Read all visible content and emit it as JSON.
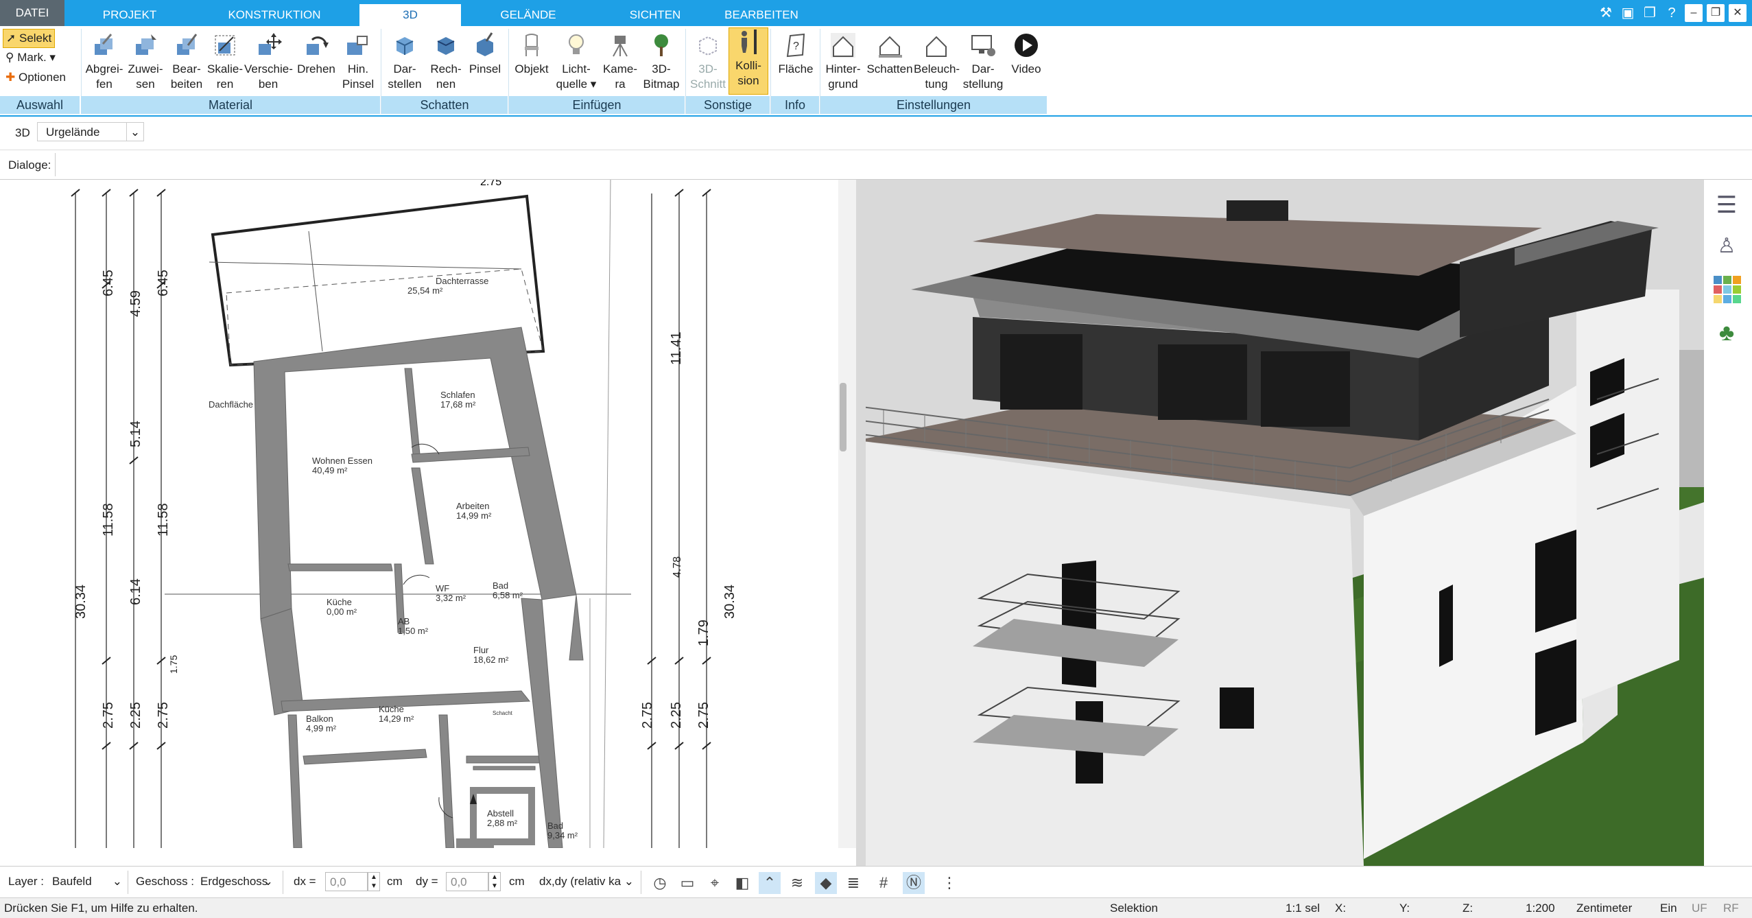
{
  "tabs": {
    "file": "DATEI",
    "project": "PROJEKT",
    "construction": "KONSTRUKTION",
    "threed": "3D",
    "terrain": "GELÄNDE",
    "views": "SICHTEN",
    "edit": "BEARBEITEN"
  },
  "ribbon": {
    "selection": {
      "select": "Selekt",
      "mark": "Mark.",
      "options": "Optionen",
      "group": "Auswahl"
    },
    "material": {
      "b1": "Abgrei-",
      "b1b": "fen",
      "b2": "Zuwei-",
      "b2b": "sen",
      "b3": "Bear-",
      "b3b": "beiten",
      "b4": "Skalie-",
      "b4b": "ren",
      "b5": "Verschie-",
      "b5b": "ben",
      "b6": "Drehen",
      "b7": "Hin.",
      "b7b": "Pinsel",
      "group": "Material"
    },
    "shadow": {
      "b1": "Dar-",
      "b1b": "stellen",
      "b2": "Rech-",
      "b2b": "nen",
      "b3": "Pinsel",
      "group": "Schatten"
    },
    "insert": {
      "b1": "Objekt",
      "b2": "Licht-",
      "b2b": "quelle",
      "b3": "Kame-",
      "b3b": "ra",
      "b4": "3D-",
      "b4b": "Bitmap",
      "group": "Einfügen"
    },
    "other": {
      "b1": "3D-",
      "b1b": "Schnitt",
      "b2": "Kolli-",
      "b2b": "sion",
      "group": "Sonstige"
    },
    "info": {
      "b1": "Fläche",
      "group": "Info"
    },
    "settings": {
      "b1": "Hinter-",
      "b1b": "grund",
      "b2": "Schatten",
      "b3": "Beleuch-",
      "b3b": "tung",
      "b4": "Dar-",
      "b4b": "stellung",
      "b5": "Video",
      "group": "Einstellungen"
    }
  },
  "toolbar3d": {
    "mode": "3D",
    "terrain_select": "Urgelände"
  },
  "dialogs_label": "Dialoge:",
  "plan": {
    "top_dim": "2.75",
    "rooms": [
      {
        "name": "Dachterrasse",
        "area": "25,54 m²"
      },
      {
        "name": "Dachfläche",
        "area": ""
      },
      {
        "name": "Schlafen",
        "area": "17,68 m²"
      },
      {
        "name": "Wohnen Essen",
        "area": "40,49 m²"
      },
      {
        "name": "Arbeiten",
        "area": "14,99 m²"
      },
      {
        "name": "Küche",
        "area": "0,00 m²"
      },
      {
        "name": "WF",
        "area": "3,32 m²"
      },
      {
        "name": "Bad",
        "area": "6,58 m²"
      },
      {
        "name": "AB",
        "area": "1,50 m²"
      },
      {
        "name": "Flur",
        "area": "18,62 m²"
      },
      {
        "name": "Schacht",
        "area": ""
      },
      {
        "name": "Balkon",
        "area": "4,99 m²"
      },
      {
        "name": "Küche",
        "area": "14,29 m²"
      },
      {
        "name": "Abstell",
        "area": "2,88 m²"
      },
      {
        "name": "Bad",
        "area": "9,34 m²"
      }
    ],
    "dims_left": [
      "6.45",
      "4.59",
      "6.45",
      "5.14",
      "11.58",
      "11.58",
      "6.14",
      "30.34",
      "2.75",
      "2.25",
      "2.75",
      "1.75"
    ],
    "dims_right": [
      "11.41",
      "4.78",
      "30.34",
      "2.75",
      "2.25",
      "2.75",
      "1.79"
    ]
  },
  "bottombar": {
    "layer_label": "Layer :",
    "layer_value": "Baufeld",
    "floor_label": "Geschoss :",
    "floor_value": "Erdgeschoss",
    "dx_label": "dx =",
    "dx_value": "0,0",
    "dx_unit": "cm",
    "dy_label": "dy =",
    "dy_value": "0,0",
    "dy_unit": "cm",
    "mode_value": "dx,dy (relativ ka"
  },
  "status": {
    "help": "Drücken Sie F1, um Hilfe zu erhalten.",
    "mode": "Selektion",
    "sel": "1:1 sel",
    "x": "X:",
    "y": "Y:",
    "z": "Z:",
    "scale": "1:200",
    "unit": "Zentimeter",
    "ein": "Ein",
    "uf": "UF",
    "rf": "RF"
  },
  "colors": {
    "accent": "#1ea0e6",
    "group_bg": "#b6e0f7",
    "selected": "#f9d66c"
  }
}
